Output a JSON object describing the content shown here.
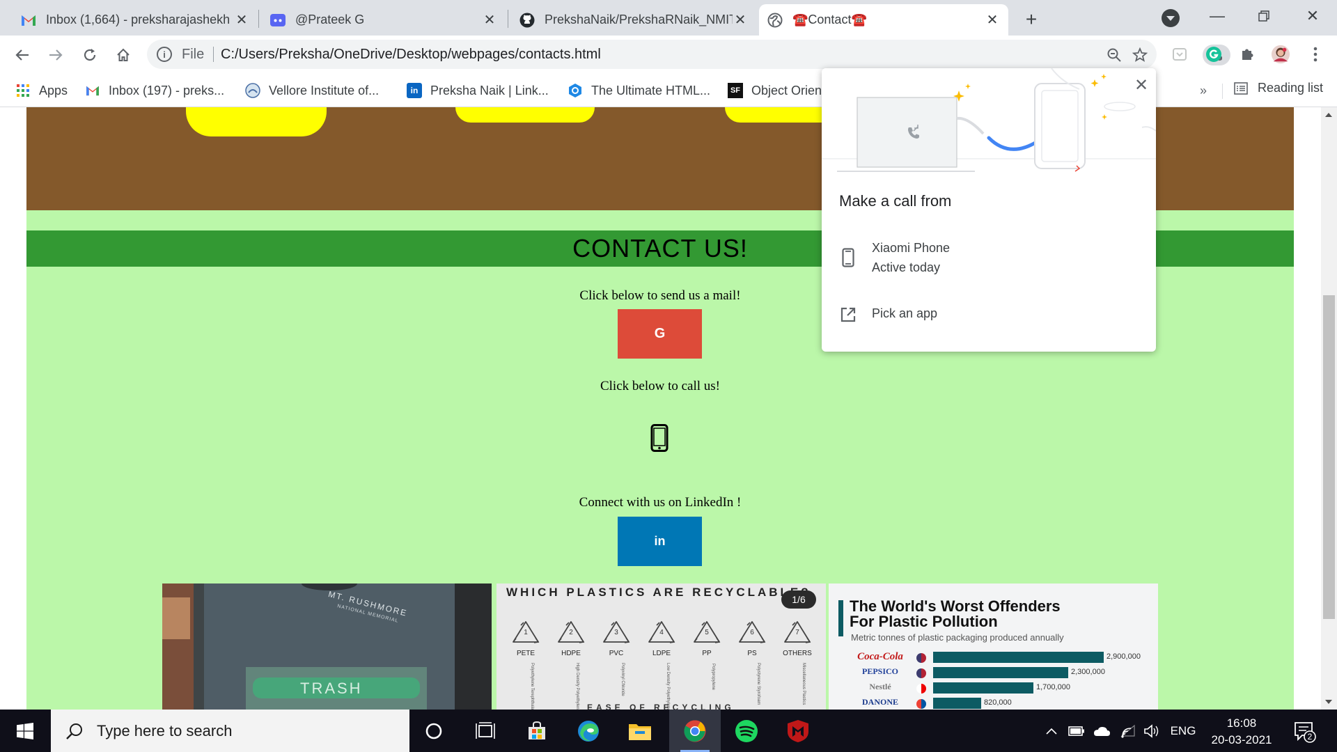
{
  "browser": {
    "tabs": [
      {
        "title": "Inbox (1,664) - preksharajashekh",
        "icon": "gmail-icon"
      },
      {
        "title": "@Prateek G",
        "icon": "discord-icon"
      },
      {
        "title": "PrekshaNaik/PrekshaRNaik_NMIT",
        "icon": "github-icon"
      },
      {
        "title": "☎️Contact☎️",
        "icon": "globe-icon"
      }
    ],
    "active_tab": 3,
    "address": {
      "scheme": "File",
      "url": "C:/Users/Preksha/OneDrive/Desktop/webpages/contacts.html"
    },
    "bookmarks": [
      {
        "label": "Apps",
        "icon": "apps-grid-icon"
      },
      {
        "label": "Inbox (197) - preks...",
        "icon": "gmail-icon"
      },
      {
        "label": "Vellore Institute of...",
        "icon": "vit-logo-icon"
      },
      {
        "label": "Preksha Naik | Link...",
        "icon": "linkedin-icon"
      },
      {
        "label": "The Ultimate HTML...",
        "icon": "html-guide-icon"
      },
      {
        "label": "Object Orien",
        "icon": "sf-icon"
      }
    ],
    "bookmarks_more": "»",
    "reading_list": "Reading list"
  },
  "call_popup": {
    "heading": "Make a call from",
    "device_name": "Xiaomi Phone",
    "device_status": "Active today",
    "pick_app": "Pick an app"
  },
  "page": {
    "contact_title": "CONTACT US!",
    "mail_prompt": "Click below to send us a mail!",
    "gmail_button": "G",
    "call_prompt": "Click below to call us!",
    "linkedin_prompt": "Connect with us on LinkedIn !",
    "linkedin_button": "in",
    "colors": {
      "brown": "#84592b",
      "yellow": "#ffff00",
      "light_green": "#bbf7a9",
      "dark_green": "#339933",
      "gmail_red": "#dd4b39",
      "linkedin_blue": "#0077b5"
    },
    "cards": {
      "tshirt_text": "MT. RUSHMORE",
      "tshirt_sub": "NATIONAL MEMORIAL",
      "trash_label": "TRASH",
      "plastics_title": "WHICH PLASTICS ARE RECYCLABLE?",
      "plastics_counter": "1/6",
      "plastics_types": [
        {
          "num": "1",
          "code": "PETE",
          "name": "Polyethylene Terephthalate"
        },
        {
          "num": "2",
          "code": "HDPE",
          "name": "High Density Polyethylene"
        },
        {
          "num": "3",
          "code": "PVC",
          "name": "Polyvinyl Chloride"
        },
        {
          "num": "4",
          "code": "LDPE",
          "name": "Low Density Polyethylene"
        },
        {
          "num": "5",
          "code": "PP",
          "name": "Polypropylene"
        },
        {
          "num": "6",
          "code": "PS",
          "name": "Polystyrene Styrofoam"
        },
        {
          "num": "7",
          "code": "OTHERS",
          "name": "Miscellaneous Plastics"
        }
      ],
      "plastics_footer": "EASE OF RECYCLING",
      "offenders_title_1": "The World's Worst Offenders",
      "offenders_title_2": "For Plastic Pollution",
      "offenders_subtitle": "Metric tonnes of plastic packaging produced annually",
      "offenders": [
        {
          "company": "Coca-Cola",
          "value": 2900000,
          "label": "2,900,000"
        },
        {
          "company": "PEPSICO",
          "value": 2300000,
          "label": "2,300,000"
        },
        {
          "company": "Nestlé",
          "value": 1700000,
          "label": "1,700,000"
        },
        {
          "company": "DANONE",
          "value": 820000,
          "label": "820,000"
        }
      ]
    }
  },
  "taskbar": {
    "search_placeholder": "Type here to search",
    "language": "ENG",
    "time": "16:08",
    "date": "20-03-2021",
    "notification_count": "2"
  }
}
